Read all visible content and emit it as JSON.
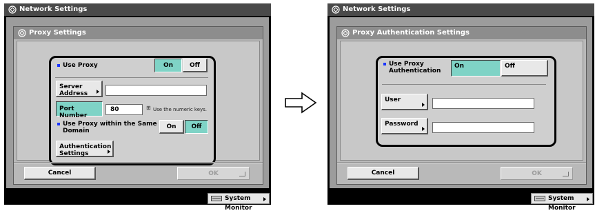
{
  "left": {
    "window_title": "Network Settings",
    "dialog_title": "Proxy Settings",
    "use_proxy_label": "Use Proxy",
    "on_label": "On",
    "off_label": "Off",
    "server_address_label": "Server\nAddress",
    "server_address_value": "",
    "port_number_label": "Port Number",
    "port_number_value": "80",
    "numeric_hint": "Use the numeric keys.",
    "same_domain_label": "Use Proxy within the Same\nDomain",
    "auth_settings_label": "Authentication\nSettings",
    "cancel_label": "Cancel",
    "ok_label": "OK",
    "system_monitor_label": "System Monitor"
  },
  "right": {
    "window_title": "Network Settings",
    "dialog_title": "Proxy Authentication Settings",
    "use_auth_label": "Use Proxy\nAuthentication",
    "on_label": "On",
    "off_label": "Off",
    "user_label": "User",
    "user_value": "",
    "password_label": "Password",
    "password_value": "",
    "cancel_label": "Cancel",
    "ok_label": "OK",
    "system_monitor_label": "System Monitor"
  },
  "colors": {
    "on_selected": "#7fd3c6",
    "bullet": "#1a35ff",
    "title_bar": "#4a4a4a"
  },
  "icons": {
    "window": "network-settings-icon",
    "transition": "right-arrow-icon",
    "numeric_keys": "numeric-keypad-icon",
    "system_monitor": "monitor-icon"
  }
}
